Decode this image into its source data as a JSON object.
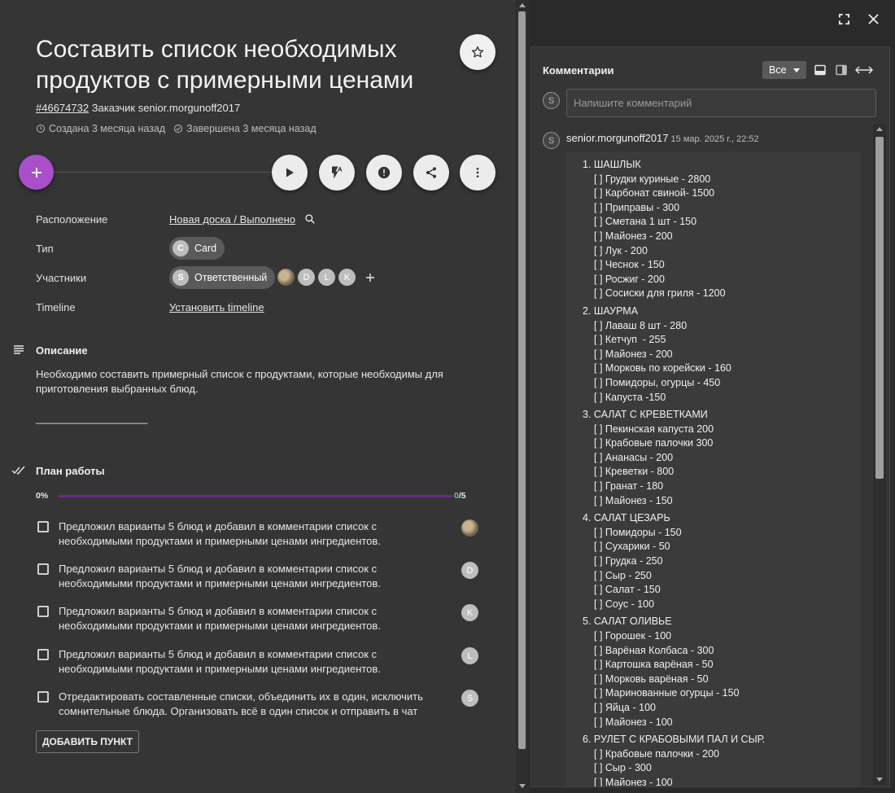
{
  "card": {
    "title": "Составить список необходимых продуктов с примерными ценами",
    "id": "#46674732",
    "customer": "Заказчик senior.morgunoff2017",
    "created": "Создана 3 месяца назад",
    "completed": "Завершена 3 месяца назад"
  },
  "props": {
    "location_label": "Расположение",
    "location_value": "Новая доска / Выполнено",
    "type_label": "Тип",
    "type_chip_letter": "C",
    "type_chip_label": "Card",
    "members_label": "Участники",
    "members_chip_letter": "S",
    "members_chip_label": "Ответственный",
    "member_avatars": [
      "D",
      "L",
      "K"
    ],
    "timeline_label": "Timeline",
    "timeline_link": "Установить timeline"
  },
  "description": {
    "heading": "Описание",
    "text": "Необходимо составить примерный список с продуктами, которые необходимы для приготовления выбранных блюд.",
    "rule": "___________________"
  },
  "plan": {
    "heading": "План работы",
    "percent": "0%",
    "progress_fraction": 0,
    "done": "0",
    "total": "/5",
    "tasks": [
      {
        "text": "Предложил варианты 5 блюд и добавил в комментарии список с необходимыми продуктами и примерными ценами ингредиентов.",
        "avatar": ""
      },
      {
        "text": "Предложил варианты 5 блюд и добавил в комментарии список с необходимыми продуктами и примерными ценами ингредиентов.",
        "avatar": "D"
      },
      {
        "text": "Предложил варианты 5 блюд и добавил в комментарии список с необходимыми продуктами и примерными ценами ингредиентов.",
        "avatar": "K"
      },
      {
        "text": "Предложил варианты 5 блюд и добавил в комментарии список с необходимыми продуктами и примерными ценами ингредиентов.",
        "avatar": "L"
      },
      {
        "text": "Отредактировать составленные списки, объединить их в один, исключить сомнительные блюда. Организовать всё в один список и отправить в чат",
        "avatar": "S"
      }
    ],
    "add_button": "ДОБАВИТЬ ПУНКТ"
  },
  "comments": {
    "heading": "Комментарии",
    "filter": "Все",
    "input_avatar": "S",
    "input_placeholder": "Напишите комментарий",
    "author_avatar": "S",
    "author": "senior.morgunoff2017",
    "time": "15 мар. 2025 г., 22:52",
    "groups": [
      {
        "title": "1. ШАШЛЫК",
        "items": [
          "[ ] Грудки куриные - 2800",
          "[ ] Карбонат свиной- 1500",
          "[ ] Приправы - 300",
          "[ ] Сметана 1 шт - 150",
          "[ ] Майонез - 200",
          "[ ] Лук - 200",
          "[ ] Чеснок - 150",
          "[ ] Росжиг - 200",
          "[ ] Сосиски для гриля - 1200"
        ]
      },
      {
        "title": "2. ШАУРМА",
        "items": [
          "[ ] Лаваш 8 шт - 280",
          "[ ] Кетчуп  - 255",
          "[ ] Майонез - 200",
          "[ ] Морковь по корейски - 160",
          "[ ] Помидоры, огурцы - 450",
          "[ ] Капуста -150"
        ]
      },
      {
        "title": "3. САЛАТ С КРЕВЕТКАМИ",
        "items": [
          "[ ] Пекинская капуста 200",
          "[ ] Крабовые палочки 300",
          "[ ] Ананасы - 200",
          "[ ] Креветки - 800",
          "[ ] Гранат - 180",
          "[ ] Майонез - 150"
        ]
      },
      {
        "title": "4. САЛАТ ЦЕЗАРЬ",
        "items": [
          "[ ] Помидоры - 150",
          "[ ] Сухарики - 50",
          "[ ] Грудка - 250",
          "[ ] Сыр - 250",
          "[ ] Салат - 150",
          "[ ] Соус - 100"
        ]
      },
      {
        "title": "5. САЛАТ ОЛИВЬЕ",
        "items": [
          "[ ] Горошек - 100",
          "[ ] Варёная Колбаса - 300",
          "[ ] Картошка варёная - 50",
          "[ ] Морковь варёная - 50",
          "[ ] Маринованные огурцы - 150",
          "[ ] Яйца - 100",
          "[ ] Майонез - 100"
        ]
      },
      {
        "title": "6. РУЛЕТ С КРАБОВЫМИ ПАЛ И СЫР.",
        "items": [
          "[ ] Крабовые палочки - 200",
          "[ ] Сыр - 300",
          "[ ] Майонез - 100"
        ]
      }
    ]
  },
  "icons": {
    "star": "star-icon",
    "add": "plus-icon",
    "play": "play-icon",
    "flash": "flash-auto-icon",
    "alert": "alert-circle-icon",
    "share": "share-icon",
    "more": "more-vert-icon",
    "search": "search-icon",
    "expand": "fullscreen-icon",
    "close": "close-icon"
  },
  "colors": {
    "accent": "#a94fc9",
    "progress": "#6a2c84",
    "background": "#353535"
  }
}
